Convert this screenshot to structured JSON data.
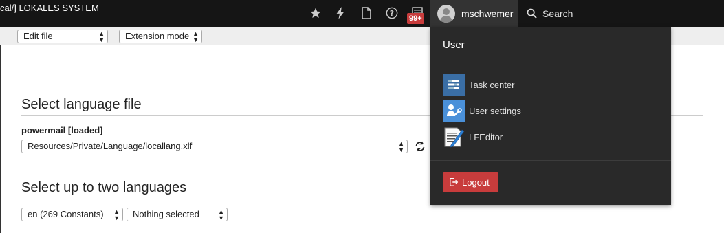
{
  "topbar": {
    "site_title": "cal/] LOKALES SYSTEM",
    "badge": "99+",
    "user_name": "mschwemer",
    "search_label": "Search"
  },
  "docheader": {
    "action_select": "Edit file",
    "mode_select": "Extension mode"
  },
  "main": {
    "language_file_heading": "Select language file",
    "extension_label": "powermail [loaded]",
    "file_select": "Resources/Private/Language/locallang.xlf",
    "languages_heading": "Select up to two languages",
    "language1_select": "en (269 Constants)",
    "language2_select": "Nothing selected"
  },
  "user_menu": {
    "title": "User",
    "items": [
      {
        "label": "Task center",
        "icon": "task-center-icon"
      },
      {
        "label": "User settings",
        "icon": "user-settings-icon"
      },
      {
        "label": "LFEditor",
        "icon": "lfeditor-icon"
      }
    ],
    "logout_label": "Logout"
  },
  "colors": {
    "topbar_bg": "#151515",
    "dropdown_bg": "#292929",
    "logout_bg": "#c83c3c",
    "badge_bg": "#c83c3c"
  }
}
